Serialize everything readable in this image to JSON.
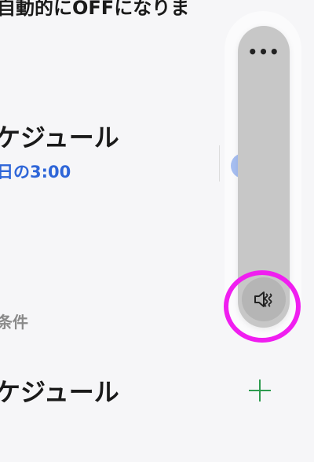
{
  "header": {
    "partial_text": "自動的にOFFになりま"
  },
  "schedule_row": {
    "title": "ケジュール",
    "subtitle": "日の3:00"
  },
  "section": {
    "label": "条件"
  },
  "add_row": {
    "title": "ケジュール",
    "add_icon": "plus-icon"
  },
  "volume_panel": {
    "more_label": "•••",
    "mute_icon": "speaker-mute-icon",
    "level_percent": 0
  },
  "colors": {
    "accent_blue": "#2f66d8",
    "add_green": "#2e9b4f",
    "highlight": "#f01ef0",
    "panel_gray": "#c7c7c7"
  }
}
